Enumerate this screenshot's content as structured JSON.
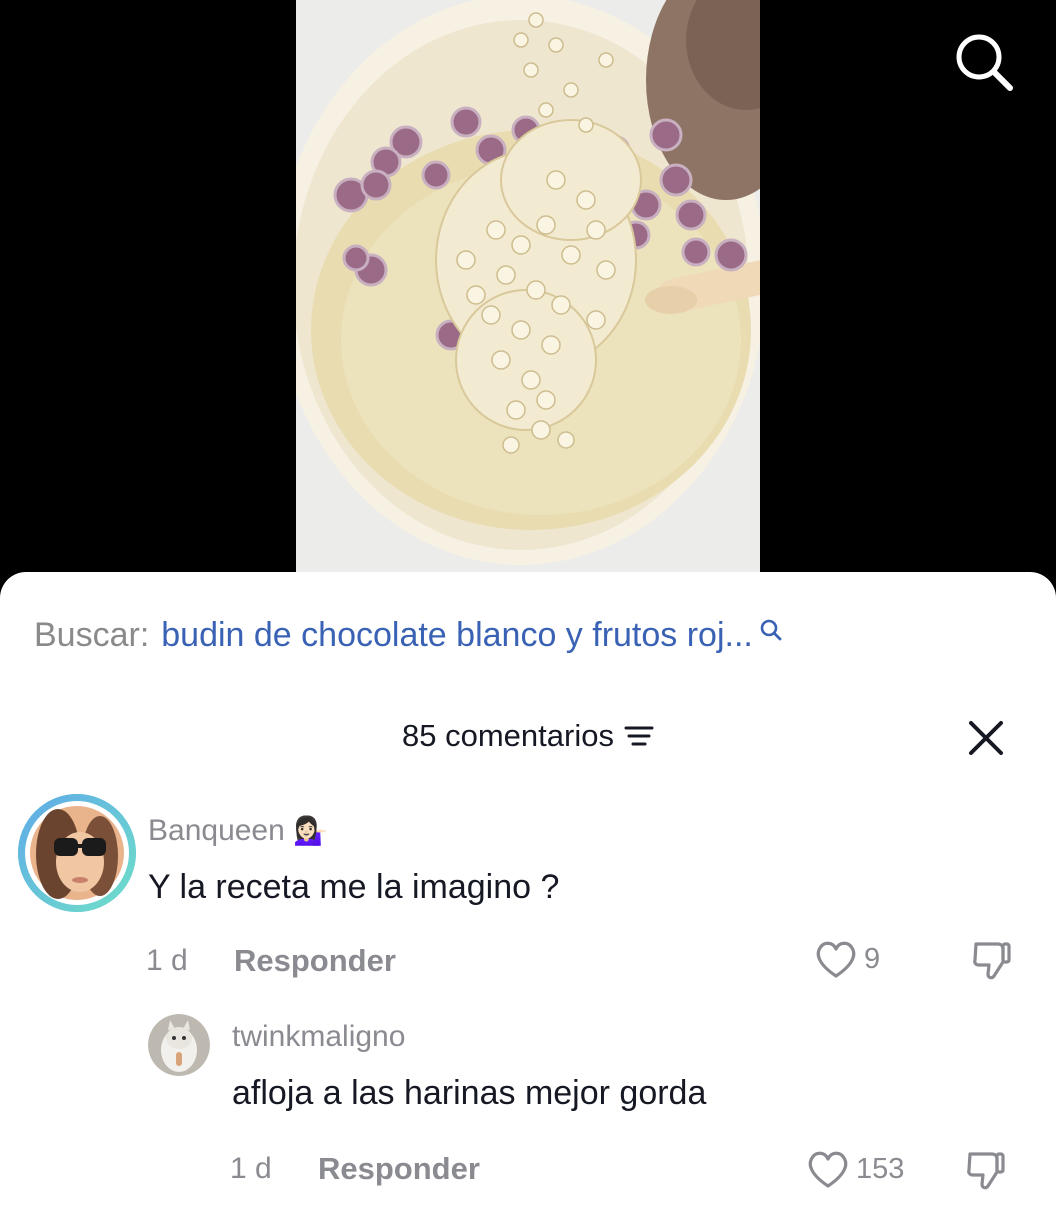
{
  "search_bar": {
    "prefix": "Buscar:",
    "query": "budin de chocolate blanco y frutos roj..."
  },
  "comments_header": {
    "count_label": "85 comentarios"
  },
  "comments": [
    {
      "username": "Banqueen",
      "emoji": "💁🏻‍♀️",
      "text": "Y la receta me la imagino ?",
      "age": "1 d",
      "reply_label": "Responder",
      "likes": "9"
    },
    {
      "username": "twinkmaligno",
      "text": "afloja a las harinas mejor gorda",
      "age": "1 d",
      "reply_label": "Responder",
      "likes": "153"
    }
  ],
  "icons": {
    "top_search": "search-icon",
    "inline_search": "search-icon",
    "sort": "sort-lines-icon",
    "close": "close-icon",
    "like": "heart-outline-icon",
    "dislike": "thumbs-down-icon"
  },
  "colors": {
    "query_link": "#3a62b4",
    "muted_text": "#8a8b91",
    "primary_text": "#161823",
    "avatar_ring": "#42c3e0"
  }
}
